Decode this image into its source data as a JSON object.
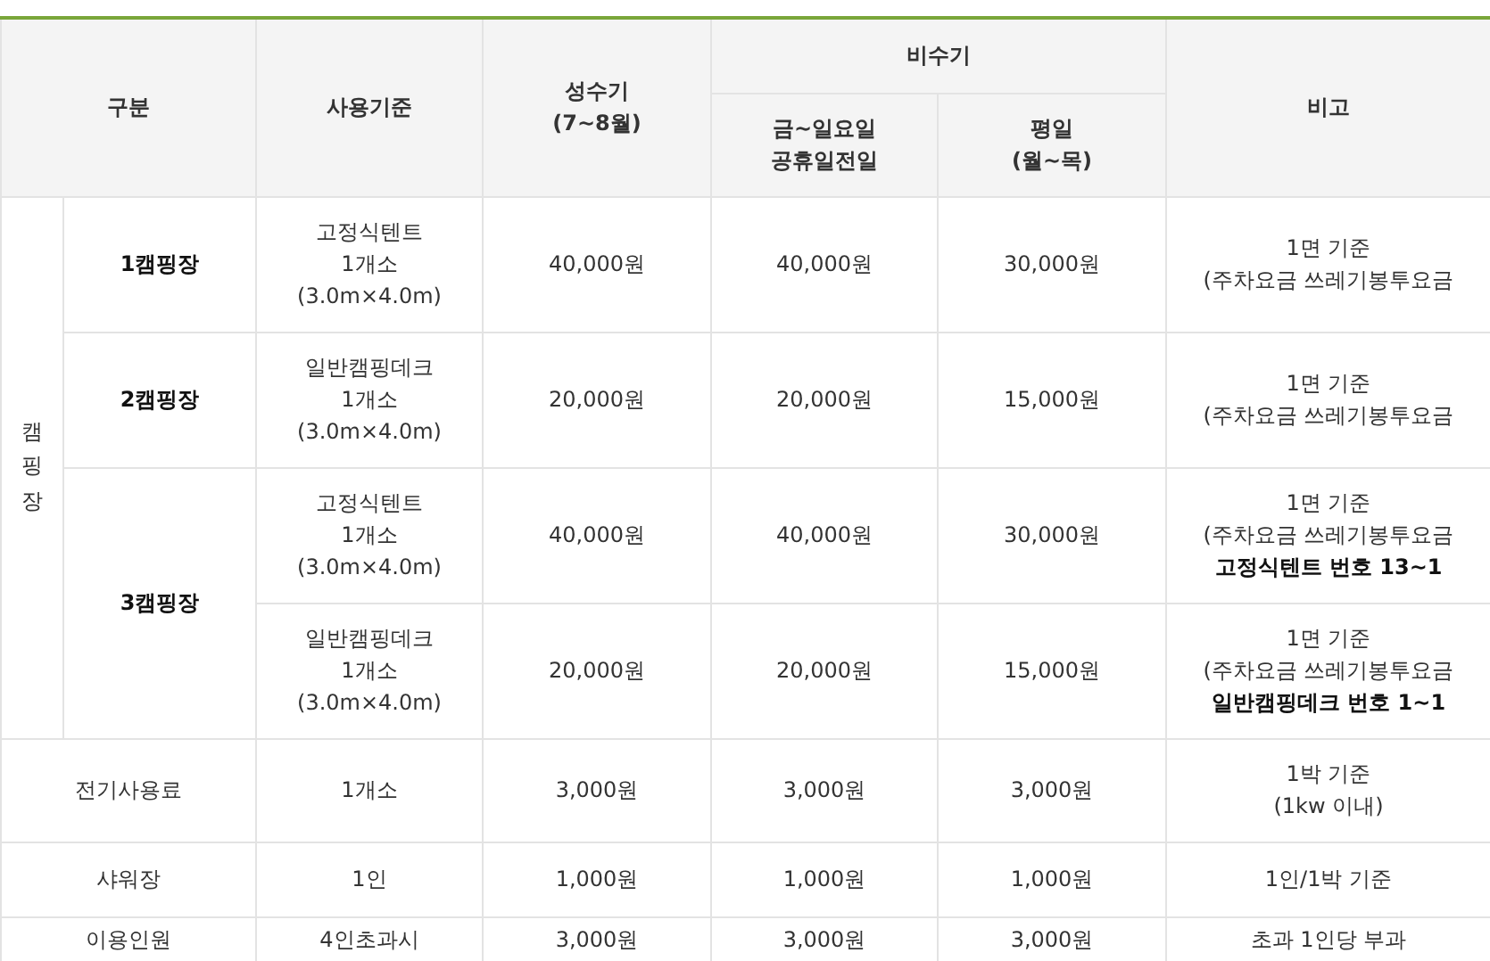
{
  "header": {
    "category": "구분",
    "standard": "사용기준",
    "peak": [
      "성수기",
      "(7~8월)"
    ],
    "off_peak": "비수기",
    "off_peak_columns": [
      [
        "금~일요일",
        "공휴일전일"
      ],
      [
        "평일",
        "(월~목)"
      ]
    ],
    "remarks": "비고"
  },
  "camping": {
    "label": "캠핑장",
    "sites": [
      {
        "name": "1캠핑장",
        "rows": [
          {
            "standard": [
              "고정식텐트",
              "1개소",
              "(3.0m×4.0m)"
            ],
            "peak": "40,000원",
            "weekend": "40,000원",
            "weekday": "30,000원",
            "remarks": [
              {
                "text": "1면 기준",
                "bold": false
              },
              {
                "text": "(주차요금 쓰레기봉투요금",
                "bold": false
              }
            ]
          }
        ]
      },
      {
        "name": "2캠핑장",
        "rows": [
          {
            "standard": [
              "일반캠핑데크",
              "1개소",
              "(3.0m×4.0m)"
            ],
            "peak": "20,000원",
            "weekend": "20,000원",
            "weekday": "15,000원",
            "remarks": [
              {
                "text": "1면 기준",
                "bold": false
              },
              {
                "text": "(주차요금 쓰레기봉투요금",
                "bold": false
              }
            ]
          }
        ]
      },
      {
        "name": "3캠핑장",
        "rows": [
          {
            "standard": [
              "고정식텐트",
              "1개소",
              "(3.0m×4.0m)"
            ],
            "peak": "40,000원",
            "weekend": "40,000원",
            "weekday": "30,000원",
            "remarks": [
              {
                "text": "1면 기준",
                "bold": false
              },
              {
                "text": "(주차요금 쓰레기봉투요금",
                "bold": false
              },
              {
                "text": "고정식텐트 번호 13~1",
                "bold": true
              }
            ]
          },
          {
            "standard": [
              "일반캠핑데크",
              "1개소",
              "(3.0m×4.0m)"
            ],
            "peak": "20,000원",
            "weekend": "20,000원",
            "weekday": "15,000원",
            "remarks": [
              {
                "text": "1면 기준",
                "bold": false
              },
              {
                "text": "(주차요금 쓰레기봉투요금",
                "bold": false
              },
              {
                "text": "일반캠핑데크 번호 1~1",
                "bold": true
              }
            ]
          }
        ]
      }
    ]
  },
  "extras": [
    {
      "name": "전기사용료",
      "standard": [
        "1개소"
      ],
      "peak": "3,000원",
      "weekend": "3,000원",
      "weekday": "3,000원",
      "remarks": [
        {
          "text": "1박 기준",
          "bold": false
        },
        {
          "text": "(1kw 이내)",
          "bold": false
        }
      ]
    },
    {
      "name": "샤워장",
      "standard": [
        "1인"
      ],
      "peak": "1,000원",
      "weekend": "1,000원",
      "weekday": "1,000원",
      "remarks": [
        {
          "text": "1인/1박 기준",
          "bold": false
        }
      ]
    },
    {
      "name": "이용인원",
      "standard": [
        "4인초과시"
      ],
      "peak": "3,000원",
      "weekend": "3,000원",
      "weekday": "3,000원",
      "remarks": [
        {
          "text": "초과 1인당 부과",
          "bold": false
        }
      ]
    }
  ]
}
